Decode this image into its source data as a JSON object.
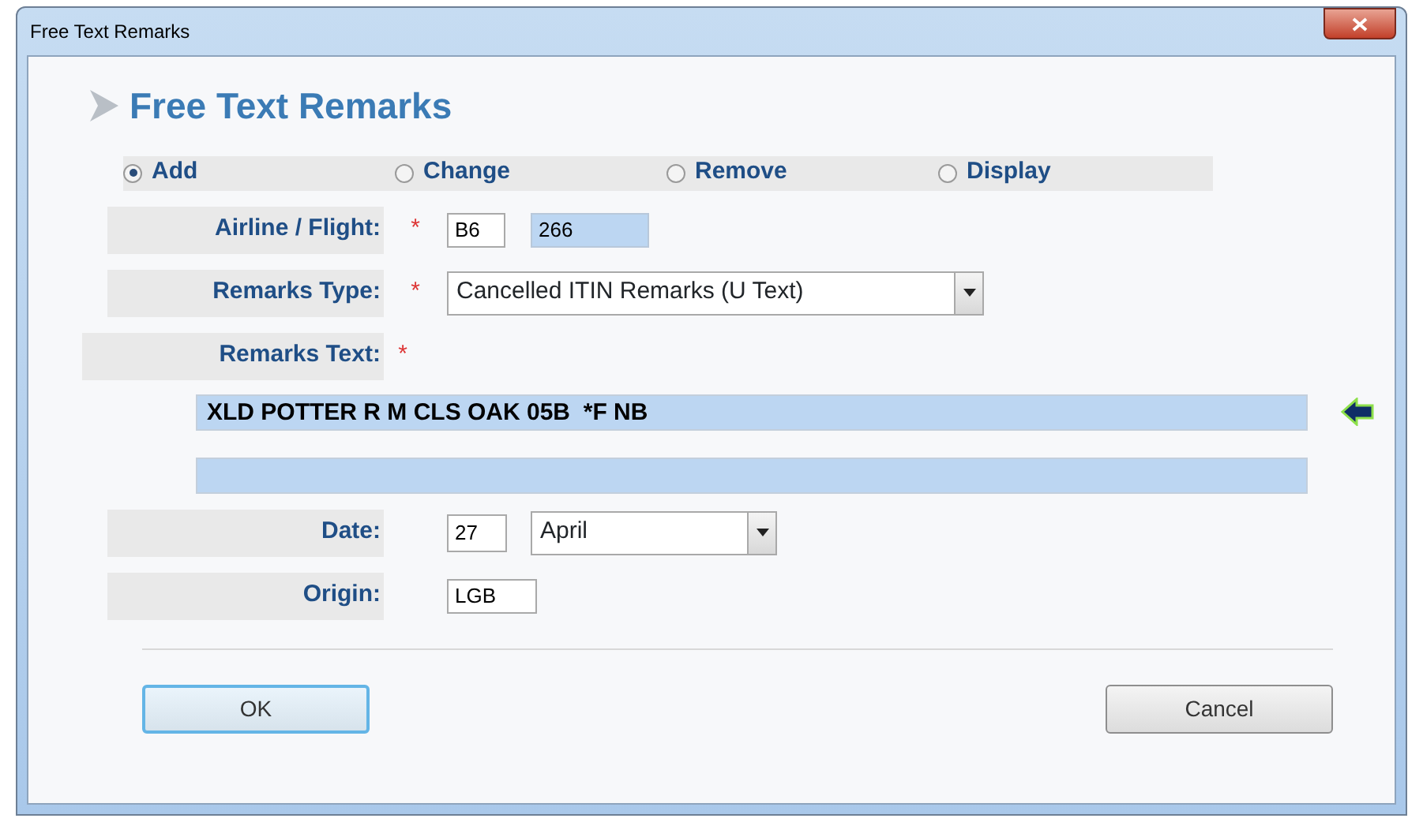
{
  "window": {
    "title": "Free Text Remarks"
  },
  "heading": "Free Text Remarks",
  "actions": [
    {
      "label": "Add",
      "selected": true
    },
    {
      "label": "Change",
      "selected": false
    },
    {
      "label": "Remove",
      "selected": false
    },
    {
      "label": "Display",
      "selected": false
    }
  ],
  "fields": [
    {
      "kind": "pair",
      "label": "Airline / Flight:",
      "required_mark": "*",
      "values": [
        {
          "value": "B6",
          "highlighted": false
        },
        {
          "value": "266",
          "highlighted": true
        }
      ]
    },
    {
      "kind": "select",
      "label": "Remarks Type:",
      "required_mark": "*",
      "value": "Cancelled ITIN Remarks (U Text)"
    },
    {
      "kind": "lines",
      "label": "Remarks Text:",
      "required_mark": "*",
      "lines": [
        {
          "value": "XLD POTTER R M CLS OAK 05B  *F NB",
          "current": true
        },
        {
          "current": false
        }
      ]
    },
    {
      "kind": "date",
      "label": "Date:",
      "day": "27",
      "month": "April"
    },
    {
      "kind": "text",
      "label": "Origin:",
      "value": "LGB"
    }
  ],
  "buttons": [
    {
      "label": "OK",
      "default": true
    },
    {
      "label": "Cancel",
      "default": false
    }
  ]
}
